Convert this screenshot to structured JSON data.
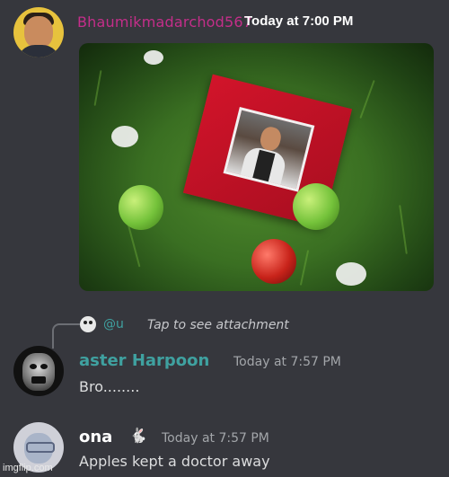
{
  "messages": [
    {
      "username": "Bhaumikmadarchod567",
      "timestamp": "Today at 7:00 PM",
      "attachment": "image"
    },
    {
      "reply": {
        "mention": "@",
        "mention_suffix": "u",
        "text": "Tap to see attachment"
      },
      "username": "aster Harpoon",
      "timestamp": "Today at 7:57 PM",
      "text": "Bro........"
    },
    {
      "username": "ona",
      "badge_icon": "rabbit-icon",
      "badge": "🐇",
      "timestamp": "Today at 7:57 PM",
      "text": "Apples kept a doctor away"
    }
  ],
  "watermark": "imgflip.com",
  "colors": {
    "background": "#36373d",
    "username1": "#c42e8a",
    "username2": "#3fa1a0",
    "text": "#dcddde",
    "timestamp": "#a3a6aa"
  }
}
